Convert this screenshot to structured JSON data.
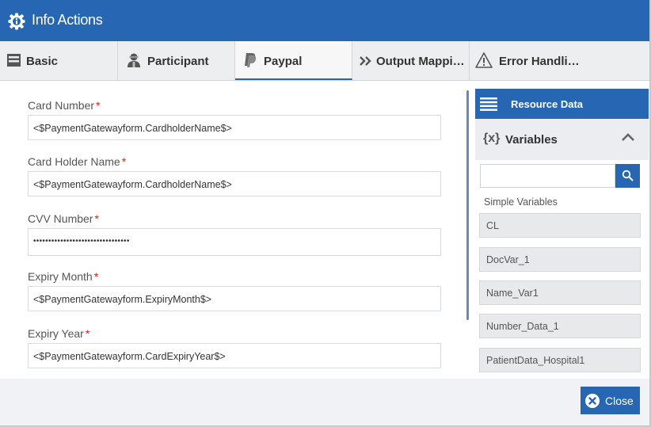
{
  "window": {
    "title": "Info Actions",
    "title_icon": "gear-info-icon"
  },
  "tabs": [
    {
      "label": "Basic",
      "icon": "form-icon"
    },
    {
      "label": "Participant",
      "icon": "user-icon"
    },
    {
      "label": "Paypal",
      "icon": "paypal-icon",
      "active": true
    },
    {
      "label": "Output Mappi…",
      "icon": "double-chevron-right-icon"
    },
    {
      "label": "Error Handli…",
      "icon": "warning-icon"
    }
  ],
  "form": {
    "required_mark": "*",
    "fields": [
      {
        "label": "Card Number",
        "value": "<$PaymentGatewayform.CardholderName$>"
      },
      {
        "label": "Card Holder Name",
        "value": "<$PaymentGatewayform.CardholderName$>"
      },
      {
        "label": "CVV Number",
        "value": "••••••••••••••••••••••••••••••••",
        "masked": true
      },
      {
        "label": "Expiry Month",
        "value": "<$PaymentGatewayform.ExpiryMonth$>"
      },
      {
        "label": "Expiry Year",
        "value": "<$PaymentGatewayform.CardExpiryYear$>"
      }
    ]
  },
  "resource_panel": {
    "title": "Resource Data",
    "variables_icon_text": "{x}",
    "variables_title": "Variables",
    "search_placeholder": "",
    "simple_variables_label": "Simple Variables",
    "items": [
      "CL",
      "DocVar_1",
      "Name_Var1",
      "Number_Data_1",
      "PatientData_Hospital1"
    ]
  },
  "footer": {
    "close_label": "Close"
  },
  "colors": {
    "primary": "#2666b3",
    "required": "#e02020"
  }
}
